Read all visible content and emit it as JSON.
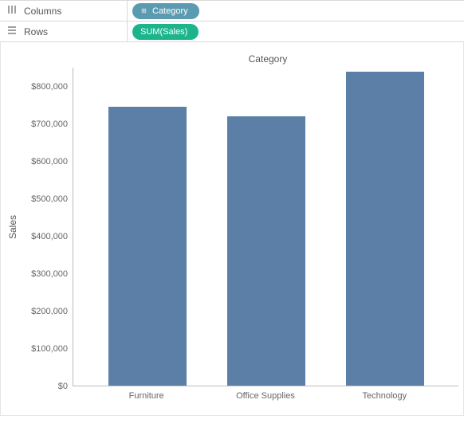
{
  "shelves": {
    "columns_label": "Columns",
    "rows_label": "Rows",
    "columns_pill": "Category",
    "rows_pill": "SUM(Sales)"
  },
  "chart_data": {
    "type": "bar",
    "title": "Category",
    "ylabel": "Sales",
    "xlabel": "",
    "categories": [
      "Furniture",
      "Office Supplies",
      "Technology"
    ],
    "values": [
      745000,
      720000,
      840000
    ],
    "ylim": [
      0,
      850000
    ],
    "yticks": [
      0,
      100000,
      200000,
      300000,
      400000,
      500000,
      600000,
      700000,
      800000
    ],
    "ytick_labels": [
      "$0",
      "$100,000",
      "$200,000",
      "$300,000",
      "$400,000",
      "$500,000",
      "$600,000",
      "$700,000",
      "$800,000"
    ],
    "bar_color": "#5b7fa6"
  }
}
